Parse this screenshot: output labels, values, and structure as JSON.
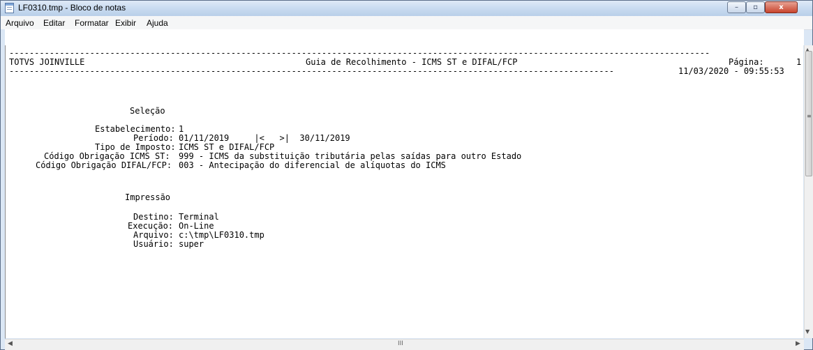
{
  "window": {
    "title": "LF0310.tmp - Bloco de notas",
    "buttons": {
      "minimize": "–",
      "maximize": "▫",
      "close": "x"
    }
  },
  "menu": [
    "Arquivo",
    "Editar",
    "Formatar",
    "Exibir",
    "Ajuda"
  ],
  "icons": [
    "notepad-icon",
    "minimize-icon",
    "maximize-icon",
    "close-icon",
    "scroll-left-icon",
    "scroll-right-icon",
    "scroll-up-icon",
    "scroll-down-icon"
  ],
  "document": {
    "rule_top": "-------------------------------------------------------------------------------------------------------------------------------------------",
    "company": "TOTVS JOINVILLE",
    "report_title": "Guia de Recolhimento - ICMS ST e DIFAL/FCP",
    "page_label": "Página:",
    "page_number": "1",
    "rule_bottom": "------------------------------------------------------------------------------------------------------------------------",
    "datetime": "11/03/2020 - 09:55:53",
    "selection_header": "Seleção",
    "selection": [
      {
        "label": "Estabelecimento:",
        "value": "1"
      },
      {
        "label": "Período:",
        "value": "01/11/2019     |<   >|  30/11/2019"
      },
      {
        "label": "Tipo de Imposto:",
        "value": "ICMS ST e DIFAL/FCP"
      },
      {
        "label": "Código Obrigação ICMS ST:",
        "value": "999 - ICMS da substituição tributária pelas saídas para outro Estado"
      },
      {
        "label": "Código Obrigação DIFAL/FCP:",
        "value": "003 - Antecipação do diferencial de alíquotas do ICMS"
      }
    ],
    "printing_header": "Impressão",
    "printing": [
      {
        "label": "Destino:",
        "value": "Terminal"
      },
      {
        "label": "Execução:",
        "value": "On-Line"
      },
      {
        "label": "Arquivo:",
        "value": "c:\\tmp\\LF0310.tmp"
      },
      {
        "label": "Usuário:",
        "value": "super"
      }
    ]
  },
  "scrollbar": {
    "h_mark": "III",
    "v_mark": "≡"
  }
}
